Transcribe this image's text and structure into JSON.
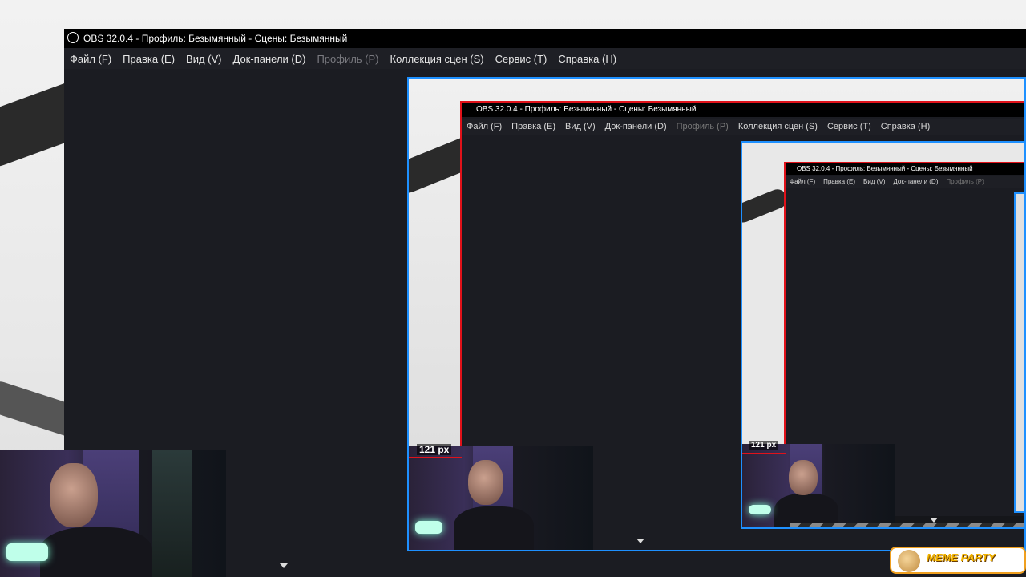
{
  "window": {
    "title": "OBS 32.0.4 - Профиль: Безымянный - Сцены: Безымянный"
  },
  "menu": [
    {
      "label": "Файл (F)",
      "disabled": false
    },
    {
      "label": "Правка (E)",
      "disabled": false
    },
    {
      "label": "Вид (V)",
      "disabled": false
    },
    {
      "label": "Док-панели (D)",
      "disabled": false
    },
    {
      "label": "Профиль (P)",
      "disabled": true
    },
    {
      "label": "Коллекция сцен (S)",
      "disabled": false
    },
    {
      "label": "Сервис (T)",
      "disabled": false
    },
    {
      "label": "Справка (H)",
      "disabled": false
    }
  ],
  "preview": {
    "nested_title": "OBS 32.0.4 - Профиль: Безымянный - Сцены: Безымянный",
    "nested_menu_level2": [
      "Файл (F)",
      "Правка (E)",
      "Вид (V)",
      "Док-панели (D)",
      "Профиль (P)",
      "Коллекция сцен (S)",
      "Сервис (T)",
      "Справка (H)"
    ],
    "nested_menu_level3": [
      "Файл (F)",
      "Правка (E)",
      "Вид (V)",
      "Док-панели (D)",
      "Профиль (P)"
    ],
    "measure_label": "121 px",
    "measure_label_2": "121 px"
  },
  "badge": {
    "text": "MEME PARTY"
  },
  "colors": {
    "selection_blue": "#1e90ff",
    "selection_red": "#e0121a",
    "window_bg": "#1b1c22",
    "titlebar": "#000000"
  }
}
